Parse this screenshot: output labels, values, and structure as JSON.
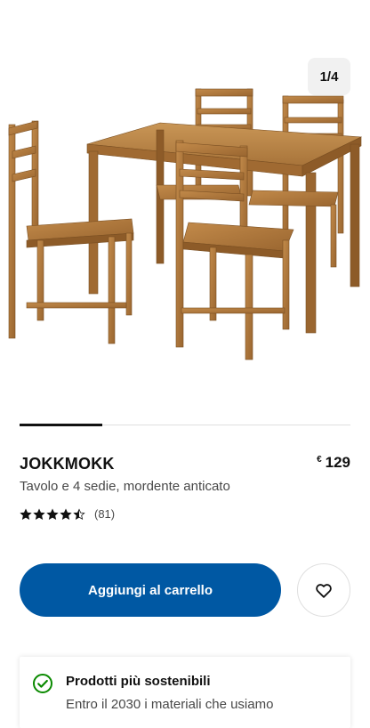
{
  "gallery": {
    "counter": "1/4",
    "progress": 0.25,
    "image_alt": "JOKKMOKK wooden table with four chairs"
  },
  "product": {
    "name": "JOKKMOKK",
    "price_currency": "€",
    "price_value": "129",
    "description": "Tavolo e 4 sedie, mordente anticato",
    "rating_value": 4.5,
    "rating_max": 5,
    "review_count": "(81)"
  },
  "actions": {
    "add_to_cart_label": "Aggiungi al carrello",
    "favorite_icon": "heart-icon"
  },
  "sustainability": {
    "icon": "check-circle-icon",
    "title": "Prodotti più sostenibili",
    "text": "Entro il 2030 i materiali che usiamo"
  },
  "colors": {
    "primary_button": "#0058a3",
    "eco_green": "#0a8a00",
    "wood": "#b07a3c"
  }
}
